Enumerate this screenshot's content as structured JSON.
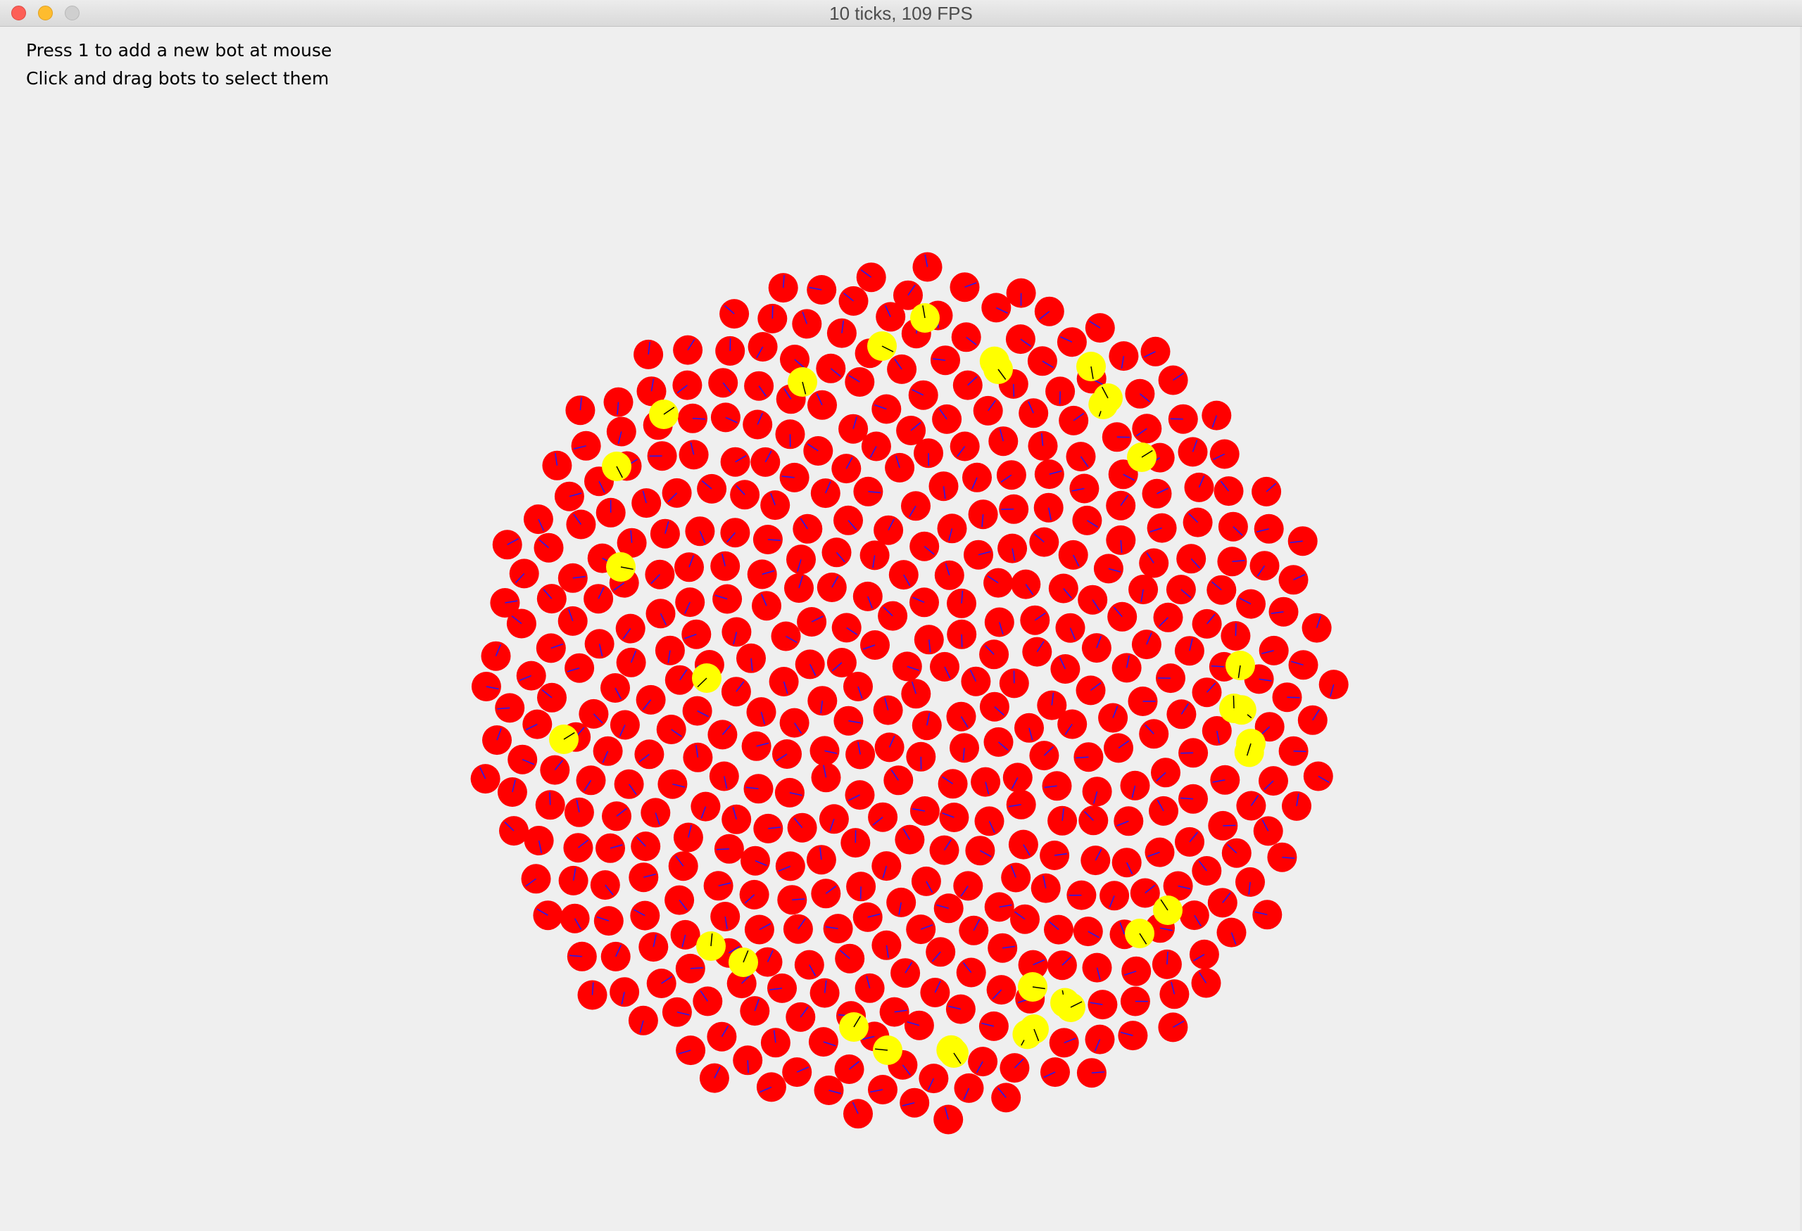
{
  "window": {
    "title": "10 ticks, 109 FPS",
    "close_icon": "close-icon",
    "minimize_icon": "minimize-icon",
    "zoom_icon": "zoom-icon"
  },
  "instructions": {
    "line1": "Press 1 to add a new bot at mouse",
    "line2": "Click and drag bots to select them"
  },
  "simulation": {
    "ticks": 10,
    "fps": 109,
    "colors": {
      "background": "#efefef",
      "bot": "#ff0000",
      "selected_bot": "#ffff00",
      "heading": "#1a1aff",
      "selected_heading": "#000000"
    }
  }
}
